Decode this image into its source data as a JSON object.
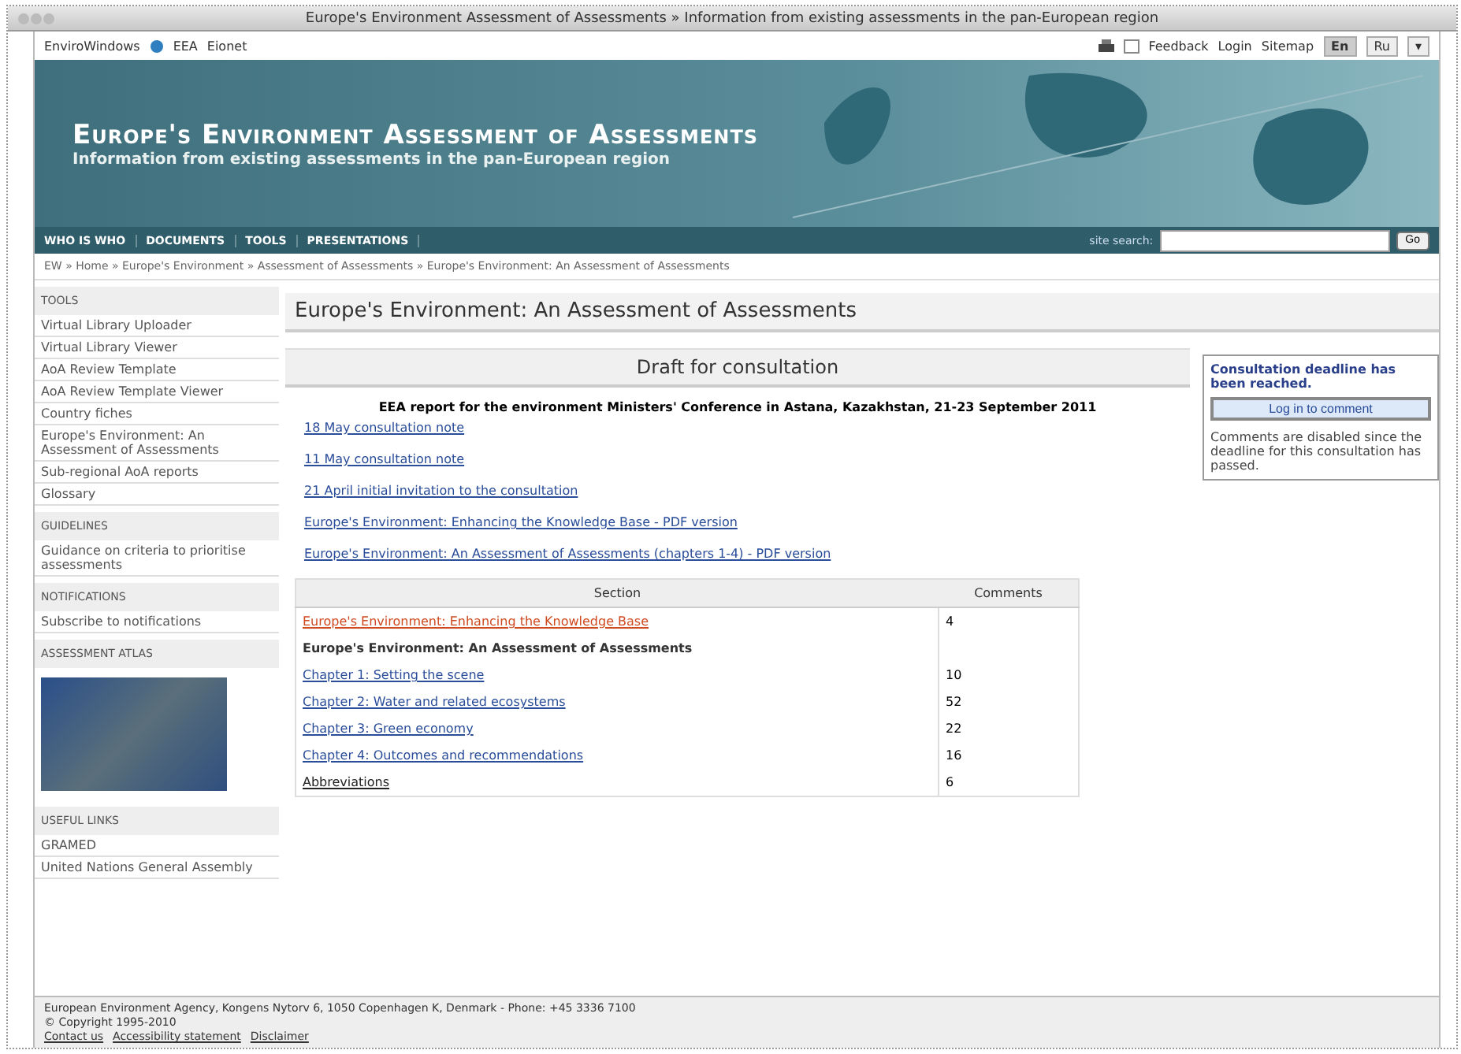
{
  "window": {
    "title": "Europe's Environment Assessment of Assessments » Information from existing assessments in the pan-European region"
  },
  "top_bar": {
    "sites": [
      "EnviroWindows",
      "EEA",
      "Eionet"
    ],
    "links": [
      "Feedback",
      "Login",
      "Sitemap"
    ],
    "languages": [
      {
        "label": "En",
        "selected": true
      },
      {
        "label": "Ru",
        "selected": false
      },
      {
        "label": "▾",
        "selected": false
      }
    ]
  },
  "banner": {
    "title": "Europe's Environment Assessment of Assessments",
    "subtitle": "Information from existing assessments in the pan-European region"
  },
  "nav": {
    "items": [
      "WHO IS WHO",
      "DOCUMENTS",
      "TOOLS",
      "PRESENTATIONS"
    ],
    "search_label": "site search:",
    "search_button": "Go"
  },
  "breadcrumb": "EW » Home » Europe's Environment » Assessment of Assessments » Europe's Environment: An Assessment of Assessments",
  "sidebar": [
    {
      "heading": "TOOLS",
      "items": [
        "Virtual Library Uploader",
        "Virtual Library Viewer",
        "AoA Review Template",
        "AoA Review Template Viewer",
        "Country fiches",
        "Europe's Environment: An Assessment of Assessments",
        "Sub-regional AoA reports",
        "Glossary"
      ]
    },
    {
      "heading": "GUIDELINES",
      "items": [
        "Guidance on criteria to prioritise assessments"
      ]
    },
    {
      "heading": "NOTIFICATIONS",
      "items": [
        "Subscribe to notifications"
      ]
    },
    {
      "heading": "ASSESSMENT ATLAS",
      "kind": "map"
    },
    {
      "heading": "USEFUL LINKS",
      "items": [
        "GRAMED",
        "United Nations General Assembly"
      ]
    }
  ],
  "main": {
    "title": "Europe's Environment: An Assessment of Assessments",
    "panel_title": "Draft for consultation",
    "intro": "EEA report for the environment Ministers' Conference in Astana, Kazakhstan, 21-23 September 2011",
    "links": [
      "18 May consultation note",
      "11 May consultation note",
      "21 April initial invitation to the consultation",
      "Europe's Environment: Enhancing the Knowledge Base - PDF version",
      "Europe's Environment: An Assessment of Assessments (chapters 1-4) - PDF version"
    ],
    "table": {
      "columns": [
        "Section",
        "Comments"
      ],
      "rows": [
        {
          "kind": "visited",
          "section": "Europe's Environment: Enhancing the Knowledge Base",
          "comments": "4"
        },
        {
          "kind": "heading",
          "section": "Europe's Environment: An Assessment of Assessments"
        },
        {
          "kind": "link",
          "section": "Chapter 1: Setting the scene",
          "comments": "10"
        },
        {
          "kind": "link",
          "section": "Chapter 2: Water and related ecosystems",
          "comments": "52"
        },
        {
          "kind": "link",
          "section": "Chapter 3: Green economy",
          "comments": "22"
        },
        {
          "kind": "link",
          "section": "Chapter 4: Outcomes and recommendations",
          "comments": "16"
        },
        {
          "kind": "dark-link",
          "section": "Abbreviations",
          "comments": "6"
        }
      ]
    }
  },
  "notice": {
    "title": "Consultation deadline has been reached.",
    "button": "Log in to comment",
    "text": "Comments are disabled since the deadline for this consultation has passed."
  },
  "footer": {
    "address": "European Environment Agency, Kongens Nytorv 6, 1050 Copenhagen K, Denmark - Phone: +45 3336 7100",
    "copyright": "© Copyright 1995-2010",
    "links": [
      "Contact us",
      "Accessibility statement",
      "Disclaimer"
    ]
  }
}
